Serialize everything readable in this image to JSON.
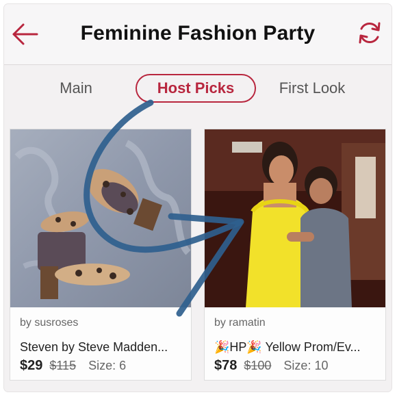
{
  "header": {
    "title": "Feminine Fashion Party",
    "back_icon": "arrow-left-icon",
    "refresh_icon": "refresh-icon",
    "accent_color": "#b8263e"
  },
  "tabs": [
    {
      "label": "Main",
      "selected": false
    },
    {
      "label": "Host Picks",
      "selected": true
    },
    {
      "label": "First Look",
      "selected": false
    }
  ],
  "listings": [
    {
      "seller": "by susroses",
      "title": "Steven by Steve Madden...",
      "price": "$29",
      "original_price": "$115",
      "size": "Size: 6"
    },
    {
      "seller": "by ramatin",
      "title": "🎉HP🎉 Yellow Prom/Ev...",
      "price": "$78",
      "original_price": "$100",
      "size": "Size: 10"
    }
  ]
}
